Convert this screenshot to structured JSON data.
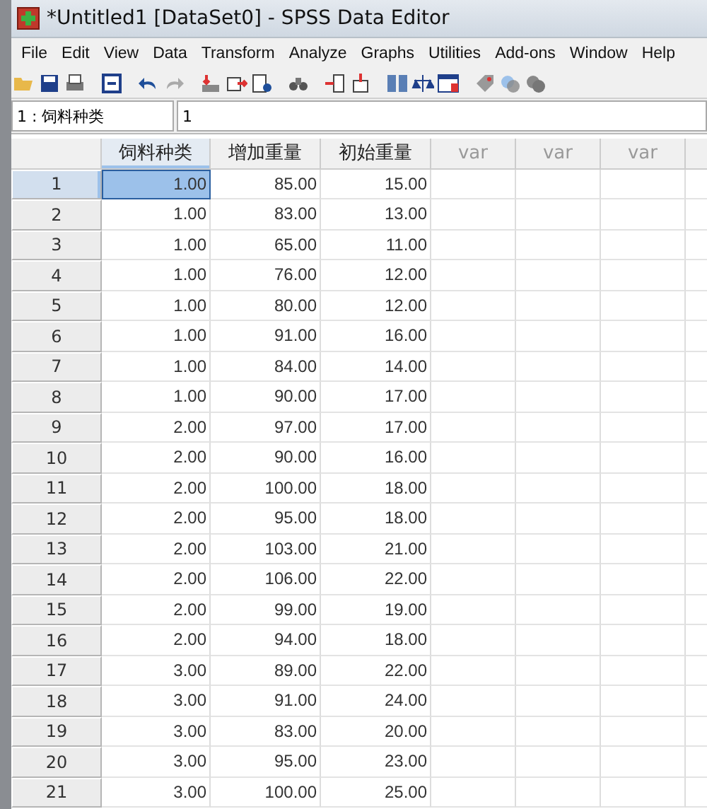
{
  "window": {
    "title": "*Untitled1 [DataSet0] - SPSS Data Editor"
  },
  "menu": [
    "File",
    "Edit",
    "View",
    "Data",
    "Transform",
    "Analyze",
    "Graphs",
    "Utilities",
    "Add-ons",
    "Window",
    "Help"
  ],
  "cell_editor": {
    "reference": "1 : 饲料种类",
    "value": "1"
  },
  "table": {
    "columns": [
      {
        "label": "饲料种类",
        "kind": "variable",
        "selected": true
      },
      {
        "label": "增加重量",
        "kind": "variable",
        "selected": false
      },
      {
        "label": "初始重量",
        "kind": "variable",
        "selected": false
      },
      {
        "label": "var",
        "kind": "empty",
        "selected": false
      },
      {
        "label": "var",
        "kind": "empty",
        "selected": false
      },
      {
        "label": "var",
        "kind": "empty",
        "selected": false
      }
    ],
    "rows": [
      {
        "case": "1",
        "cells": [
          "1.00",
          "85.00",
          "15.00"
        ],
        "selected": true
      },
      {
        "case": "2",
        "cells": [
          "1.00",
          "83.00",
          "13.00"
        ],
        "selected": false
      },
      {
        "case": "3",
        "cells": [
          "1.00",
          "65.00",
          "11.00"
        ],
        "selected": false
      },
      {
        "case": "4",
        "cells": [
          "1.00",
          "76.00",
          "12.00"
        ],
        "selected": false
      },
      {
        "case": "5",
        "cells": [
          "1.00",
          "80.00",
          "12.00"
        ],
        "selected": false
      },
      {
        "case": "6",
        "cells": [
          "1.00",
          "91.00",
          "16.00"
        ],
        "selected": false
      },
      {
        "case": "7",
        "cells": [
          "1.00",
          "84.00",
          "14.00"
        ],
        "selected": false
      },
      {
        "case": "8",
        "cells": [
          "1.00",
          "90.00",
          "17.00"
        ],
        "selected": false
      },
      {
        "case": "9",
        "cells": [
          "2.00",
          "97.00",
          "17.00"
        ],
        "selected": false
      },
      {
        "case": "10",
        "cells": [
          "2.00",
          "90.00",
          "16.00"
        ],
        "selected": false
      },
      {
        "case": "11",
        "cells": [
          "2.00",
          "100.00",
          "18.00"
        ],
        "selected": false
      },
      {
        "case": "12",
        "cells": [
          "2.00",
          "95.00",
          "18.00"
        ],
        "selected": false
      },
      {
        "case": "13",
        "cells": [
          "2.00",
          "103.00",
          "21.00"
        ],
        "selected": false
      },
      {
        "case": "14",
        "cells": [
          "2.00",
          "106.00",
          "22.00"
        ],
        "selected": false
      },
      {
        "case": "15",
        "cells": [
          "2.00",
          "99.00",
          "19.00"
        ],
        "selected": false
      },
      {
        "case": "16",
        "cells": [
          "2.00",
          "94.00",
          "18.00"
        ],
        "selected": false
      },
      {
        "case": "17",
        "cells": [
          "3.00",
          "89.00",
          "22.00"
        ],
        "selected": false
      },
      {
        "case": "18",
        "cells": [
          "3.00",
          "91.00",
          "24.00"
        ],
        "selected": false
      },
      {
        "case": "19",
        "cells": [
          "3.00",
          "83.00",
          "20.00"
        ],
        "selected": false
      },
      {
        "case": "20",
        "cells": [
          "3.00",
          "95.00",
          "23.00"
        ],
        "selected": false
      },
      {
        "case": "21",
        "cells": [
          "3.00",
          "100.00",
          "25.00"
        ],
        "selected": false
      }
    ]
  }
}
